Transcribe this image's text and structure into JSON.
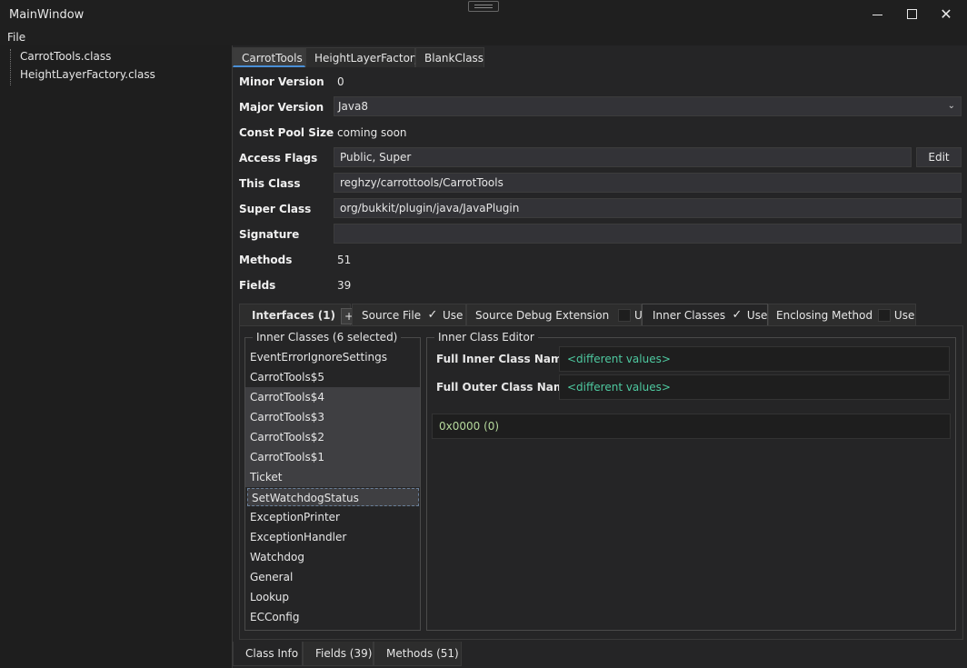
{
  "window": {
    "title": "MainWindow",
    "min": "",
    "close": "✕"
  },
  "menu": {
    "file": "File"
  },
  "tree": {
    "items": [
      "CarrotTools.class",
      "HeightLayerFactory.class"
    ]
  },
  "tabs": [
    "CarrotTools",
    "HeightLayerFactory",
    "BlankClass"
  ],
  "props": {
    "minor_label": "Minor Version",
    "minor": "0",
    "major_label": "Major Version",
    "major": "Java8",
    "pool_label": "Const Pool Size",
    "pool": "coming soon",
    "access_label": "Access Flags",
    "access": "Public, Super",
    "edit": "Edit",
    "this_label": "This Class",
    "this_class": "reghzy/carrottools/CarrotTools",
    "super_label": "Super Class",
    "super_class": "org/bukkit/plugin/java/JavaPlugin",
    "sig_label": "Signature",
    "signature": "",
    "methods_label": "Methods",
    "methods": "51",
    "fields_label": "Fields",
    "fields": "39"
  },
  "subtabs": {
    "interfaces": "Interfaces (1)",
    "plus": "+",
    "source_file": "Source File",
    "source_debug": "Source Debug Extension",
    "inner_classes": "Inner Classes",
    "enclosing": "Enclosing Method",
    "use": "Use",
    "check": "✓"
  },
  "inner_list": {
    "legend": "Inner Classes (6 selected)",
    "items": [
      "EventErrorIgnoreSettings",
      "CarrotTools$5",
      "CarrotTools$4",
      "CarrotTools$3",
      "CarrotTools$2",
      "CarrotTools$1",
      "Ticket",
      "SetWatchdogStatus",
      "ExceptionPrinter",
      "ExceptionHandler",
      "Watchdog",
      "General",
      "Lookup",
      "ECConfig"
    ]
  },
  "editor": {
    "legend": "Inner Class Editor",
    "inner_label": "Full Inner Class Name",
    "inner_value": "<different values>",
    "outer_label": "Full Outer Class Name",
    "outer_value": "<different values>",
    "flags": "0x0000 (0)"
  },
  "bottom_tabs": [
    "Class Info",
    "Fields (39)",
    "Methods (51)"
  ],
  "icons": {
    "chevron": "chevron-down-icon",
    "check": "check-icon"
  }
}
